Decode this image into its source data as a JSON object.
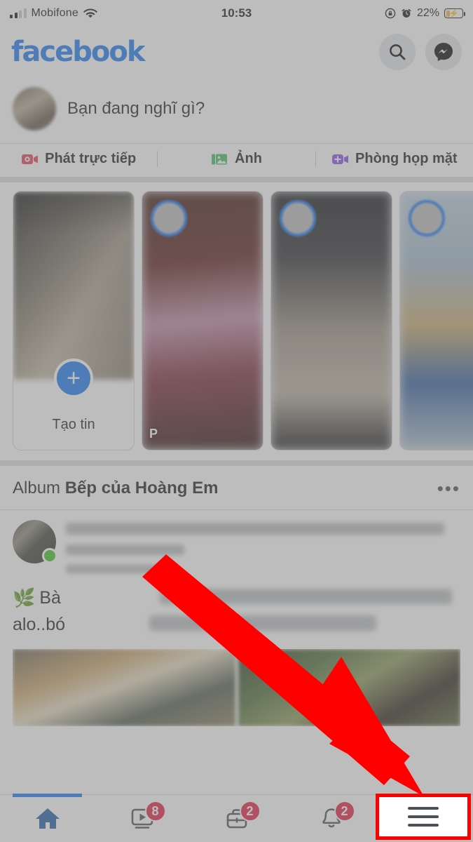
{
  "status_bar": {
    "carrier": "Mobifone",
    "signal_icon": "signal-bars-icon",
    "wifi_icon": "wifi-icon",
    "time": "10:53",
    "rotation_lock_icon": "rotation-lock-icon",
    "alarm_icon": "alarm-clock-icon",
    "battery_percent": "22%",
    "battery_charging_icon": "battery-charging-icon",
    "battery_level": 22
  },
  "header": {
    "logo_text": "facebook",
    "logo_color": "#1877F2",
    "search_icon": "search-icon",
    "messenger_icon": "messenger-icon"
  },
  "composer": {
    "avatar": "user-avatar",
    "placeholder": "Bạn đang nghĩ gì?",
    "actions": [
      {
        "label": "Phát trực tiếp",
        "icon": "live-video-icon",
        "color": "#e4405f"
      },
      {
        "label": "Ảnh",
        "icon": "photo-icon",
        "color": "#45bd62"
      },
      {
        "label": "Phòng họp mặt",
        "icon": "room-video-icon",
        "color": "#8a4ee2"
      }
    ]
  },
  "stories": {
    "create_label": "Tạo tin",
    "create_icon": "plus-icon",
    "items": [
      {
        "label": "",
        "ring": true
      },
      {
        "label": "P",
        "ring": true
      },
      {
        "label": "",
        "ring": true
      },
      {
        "label": "",
        "ring": true
      }
    ]
  },
  "album": {
    "prefix": "Album",
    "name": "Bếp của Hoàng Em",
    "menu_icon": "more-options-icon"
  },
  "post": {
    "avatar": "poster-avatar",
    "online_indicator": "online-status-dot",
    "online_color": "#3ec31f",
    "body_line1_emoji": "🌿",
    "body_line1_visible": "Bà",
    "body_line2_visible": "alo..bó",
    "photo_count": 2
  },
  "annotation": {
    "arrow_color": "#ff0000",
    "arrow_target": "menu-tab",
    "highlight_color": "#ff0000"
  },
  "bottom_nav": {
    "items": [
      {
        "name": "home",
        "icon": "home-icon",
        "badge": "",
        "active": true
      },
      {
        "name": "watch",
        "icon": "video-play-icon",
        "badge": "8",
        "active": false
      },
      {
        "name": "marketplace",
        "icon": "marketplace-icon",
        "badge": "2",
        "active": false
      },
      {
        "name": "notifications",
        "icon": "bell-icon",
        "badge": "2",
        "active": false
      },
      {
        "name": "menu",
        "icon": "hamburger-menu-icon",
        "badge": "",
        "active": false
      }
    ],
    "badge_color": "#e41e3f",
    "active_color": "#1877F2"
  }
}
